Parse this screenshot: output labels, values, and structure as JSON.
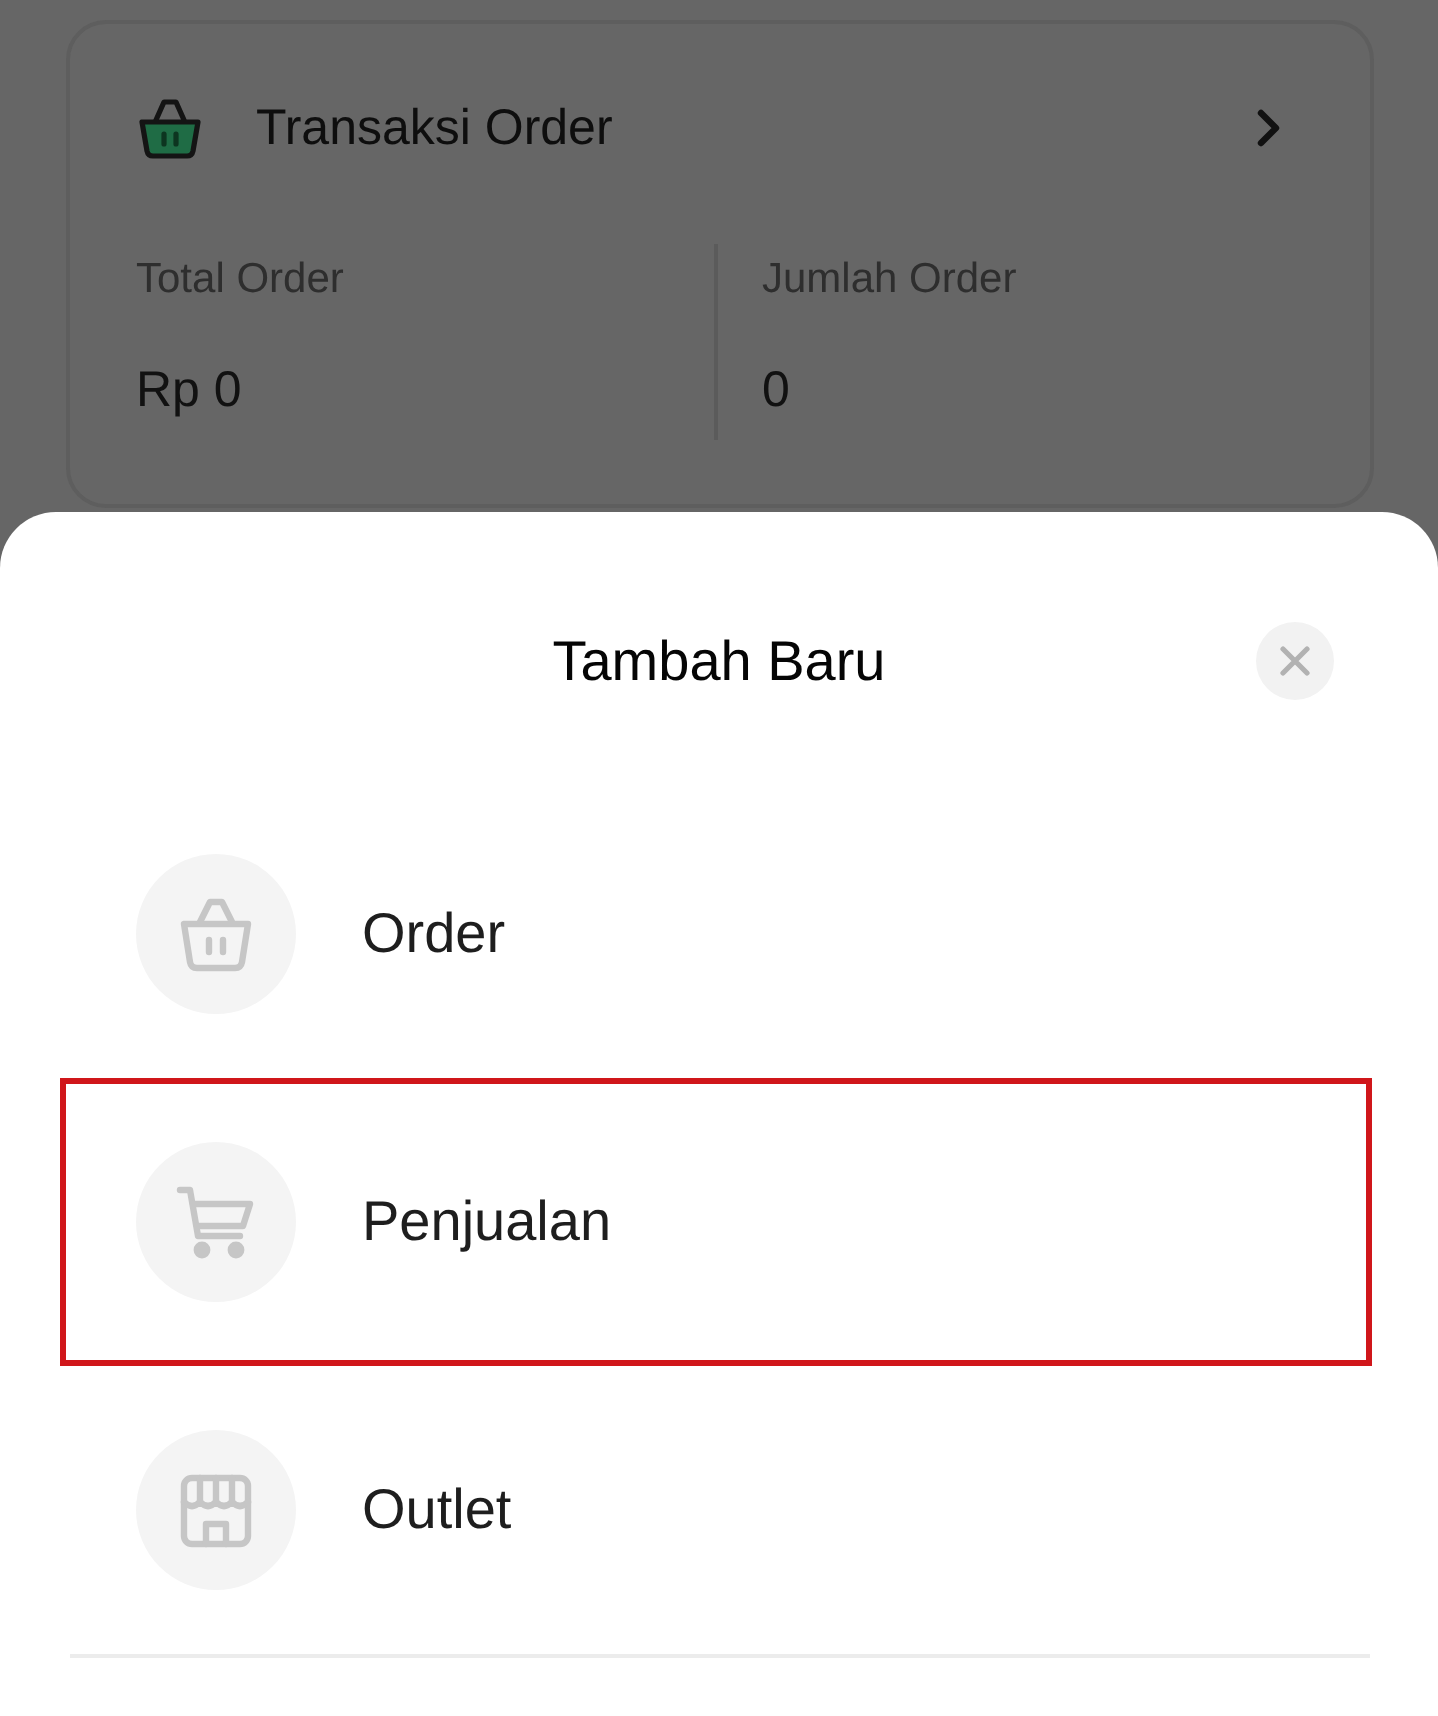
{
  "page": {
    "card": {
      "title": "Transaksi Order",
      "stats": [
        {
          "label": "Total Order",
          "value": "Rp 0"
        },
        {
          "label": "Jumlah Order",
          "value": "0"
        }
      ]
    }
  },
  "sheet": {
    "title": "Tambah Baru",
    "items": [
      {
        "kind": "basket",
        "label": "Order",
        "highlighted": false
      },
      {
        "kind": "cart",
        "label": "Penjualan",
        "highlighted": true
      },
      {
        "kind": "store",
        "label": "Outlet",
        "highlighted": false
      }
    ]
  }
}
